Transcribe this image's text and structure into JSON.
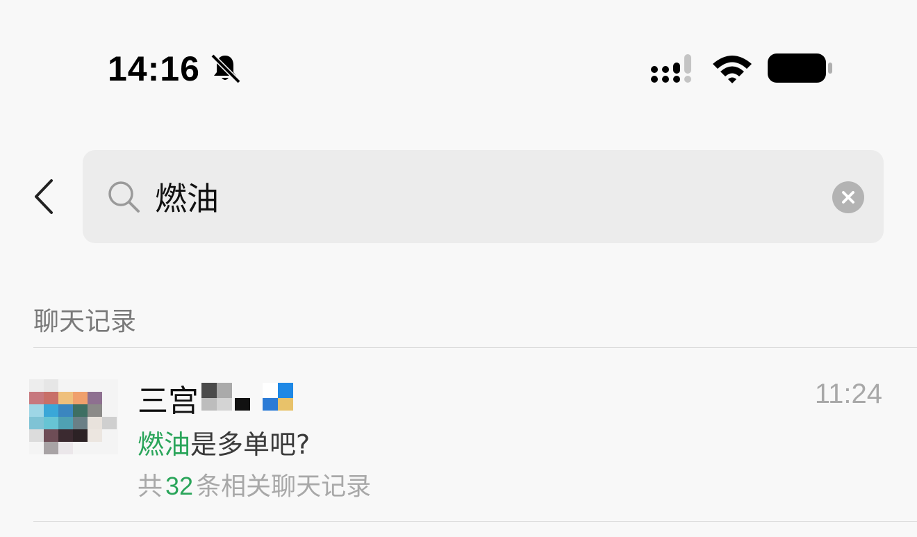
{
  "status_bar": {
    "time": "14:16",
    "icons": [
      "bell-slash-icon",
      "cellular-signal-icon",
      "wifi-icon",
      "battery-icon"
    ]
  },
  "search": {
    "query": "燃油",
    "back_icon": "chevron-left-icon",
    "search_icon": "search-icon",
    "clear_icon": "clear-circle-icon"
  },
  "section": {
    "title": "聊天记录"
  },
  "results": [
    {
      "name": "三宫",
      "time": "11:24",
      "message_keyword": "燃油",
      "message_rest": "是多单吧?",
      "count_prefix": "共",
      "count": "32",
      "count_suffix": "条相关聊天记录"
    }
  ],
  "colors": {
    "background": "#f8f8f8",
    "search_box": "#ececec",
    "highlight": "#2aa55a",
    "secondary_text": "#a8a8a8",
    "section_text": "#7a7a7a"
  }
}
